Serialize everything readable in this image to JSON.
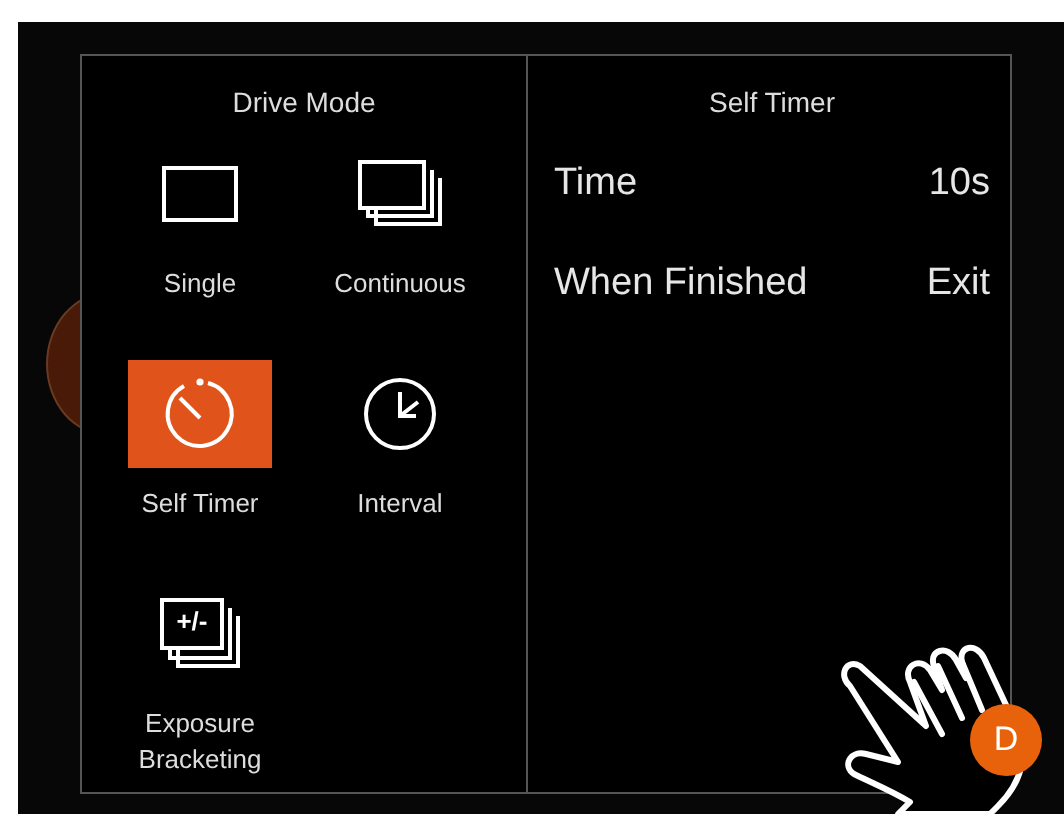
{
  "drive_mode": {
    "title": "Drive Mode",
    "items": [
      {
        "label": "Single",
        "kind": "single",
        "selected": false
      },
      {
        "label": "Continuous",
        "kind": "continuous",
        "selected": false
      },
      {
        "label": "Self Timer",
        "kind": "self_timer",
        "selected": true
      },
      {
        "label": "Interval",
        "kind": "interval",
        "selected": false
      },
      {
        "label": "Exposure Bracketing",
        "kind": "bracketing",
        "icon_text": "+/-",
        "selected": false
      }
    ]
  },
  "self_timer": {
    "title": "Self Timer",
    "settings": [
      {
        "label": "Time",
        "value": "10s"
      },
      {
        "label": "When Finished",
        "value": "Exit"
      }
    ]
  },
  "cursor_badge": "D"
}
